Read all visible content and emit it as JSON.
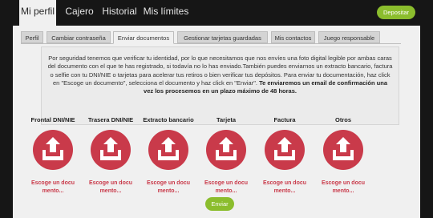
{
  "top_nav": {
    "tabs": [
      {
        "label": "Mi perfil"
      },
      {
        "label": "Cajero"
      },
      {
        "label": "Historial"
      },
      {
        "label": "Mis límites"
      }
    ],
    "deposit_label": "Depositar"
  },
  "sub_nav": {
    "tabs": [
      {
        "label": "Perfil"
      },
      {
        "label": "Cambiar contraseña"
      },
      {
        "label": "Enviar documentos"
      },
      {
        "label": "Gestionar tarjetas guardadas"
      },
      {
        "label": "Mis contactos"
      },
      {
        "label": "Juego responsable"
      }
    ],
    "active_index": 2
  },
  "info": {
    "text": "Por seguridad tenemos que verificar tu identidad, por lo que necesitamos que nos envíes una foto digital legible por ambas caras del documento con el que te has registrado, si todavía no lo has enviado.También puedes enviarnos un extracto bancario, factura o selfie con tu DNI/NIE o tarjetas para acelerar tus retiros o bien verificar tus depósitos. Para enviar tu documentación, haz click en \"Escoge un documento\", selecciona el documento y haz click en \"Enviar\".",
    "bold_text": "Te enviaremos un email de confirmación una vez los procesemos en un plazo máximo de 48 horas."
  },
  "documents": [
    {
      "title": "Frontal DNI/NIE",
      "link_line1": "Escoge un docu",
      "link_line2": "mento..."
    },
    {
      "title": "Trasera DNI/NIE",
      "link_line1": "Escoge un docu",
      "link_line2": "mento..."
    },
    {
      "title": "Extracto bancario",
      "link_line1": "Escoge un docu",
      "link_line2": "mento..."
    },
    {
      "title": "Tarjeta",
      "link_line1": "Escoge un docu",
      "link_line2": "mento..."
    },
    {
      "title": "Factura",
      "link_line1": "Escoge un docu",
      "link_line2": "mento..."
    },
    {
      "title": "Otros",
      "link_line1": "Escoge un docu",
      "link_line2": "mento..."
    }
  ],
  "send_label": "Enviar",
  "icons": {
    "upload": "upload-tray-icon"
  },
  "colors": {
    "accent_green": "#8bbd2d",
    "accent_red": "#c93a4a",
    "dark_bg": "#161616",
    "panel_bg": "#f0f0f0"
  }
}
